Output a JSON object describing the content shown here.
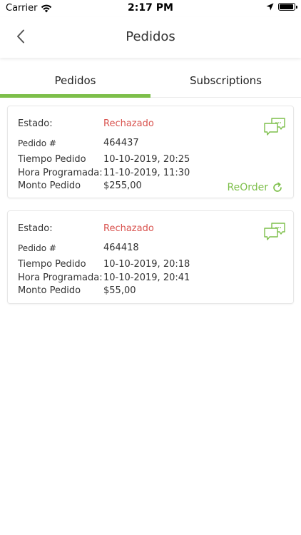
{
  "status_bar": {
    "carrier": "Carrier",
    "time": "2:17 PM"
  },
  "nav": {
    "title": "Pedidos"
  },
  "tabs": [
    {
      "label": "Pedidos",
      "active": true
    },
    {
      "label": "Subscriptions",
      "active": false
    }
  ],
  "labels": {
    "estado": "Estado:",
    "pedido": "Pedido #",
    "tiempo": "Tiempo Pedido",
    "hora": "Hora Programada:",
    "monto": "Monto Pedido"
  },
  "orders": [
    {
      "estado": "Rechazado",
      "pedido": "464437",
      "tiempo": "10-10-2019, 20:25",
      "hora": "11-10-2019, 11:30",
      "monto": "$255,00",
      "reorder_label": "ReOrder"
    },
    {
      "estado": "Rechazado",
      "pedido": "464418",
      "tiempo": "10-10-2019, 20:18",
      "hora": "10-10-2019, 20:41",
      "monto": "$55,00"
    }
  ],
  "colors": {
    "accent": "#7dbf4a",
    "status_rejected": "#d9534f"
  },
  "icons": [
    "wifi-icon",
    "location-arrow-icon",
    "battery-icon",
    "back-chevron-icon",
    "chat-bubbles-icon",
    "refresh-icon"
  ]
}
